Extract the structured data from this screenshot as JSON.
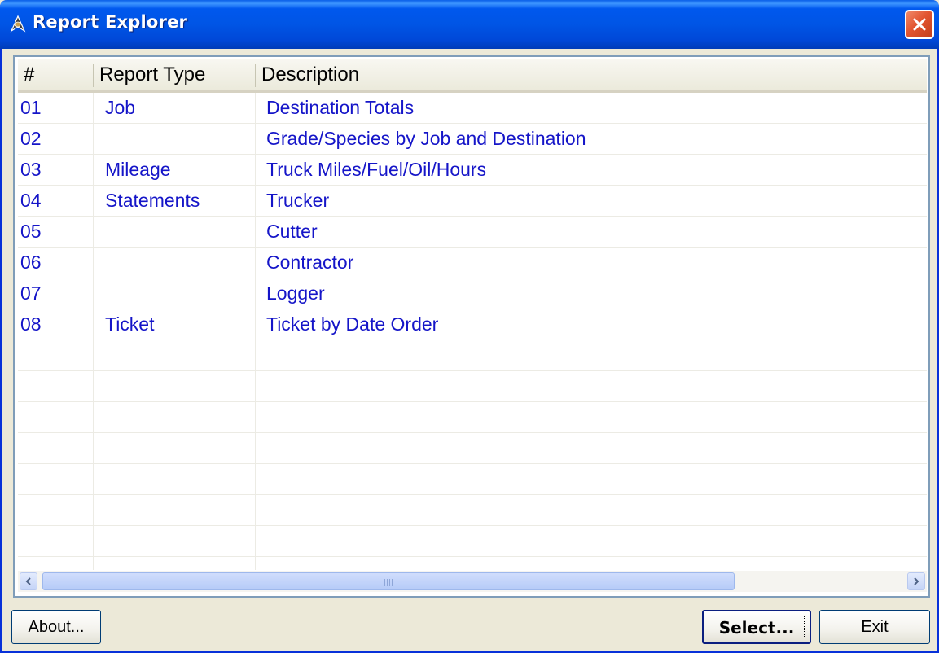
{
  "window": {
    "title": "Report Explorer"
  },
  "colors": {
    "title_bar": "#0055E5",
    "row_text": "#1515C8",
    "close_button": "#E2542F",
    "window_bg": "#ECE9D8"
  },
  "icons": {
    "app": "compass-icon",
    "close": "close-x-icon",
    "scroll_left": "arrow-left-icon",
    "scroll_right": "arrow-right-icon"
  },
  "table": {
    "columns": [
      "#",
      "Report Type",
      "Description"
    ],
    "rows": [
      {
        "num": "01",
        "type": "Job",
        "description": "Destination Totals"
      },
      {
        "num": "02",
        "type": "",
        "description": "Grade/Species by Job and Destination"
      },
      {
        "num": "03",
        "type": "Mileage",
        "description": "Truck Miles/Fuel/Oil/Hours"
      },
      {
        "num": "04",
        "type": "Statements",
        "description": "Trucker"
      },
      {
        "num": "05",
        "type": "",
        "description": "Cutter"
      },
      {
        "num": "06",
        "type": "",
        "description": "Contractor"
      },
      {
        "num": "07",
        "type": "",
        "description": "Logger"
      },
      {
        "num": "08",
        "type": "Ticket",
        "description": "Ticket by Date Order"
      }
    ]
  },
  "buttons": {
    "about": "About...",
    "select": "Select...",
    "exit": "Exit"
  }
}
